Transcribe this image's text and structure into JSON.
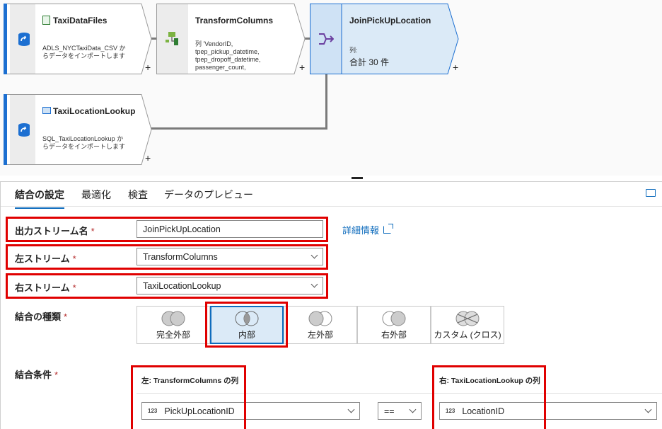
{
  "nodes": [
    {
      "title": "TaxiDataFiles",
      "desc": "ADLS_NYCTaxiData_CSV からデータをインポートします",
      "icon": "source-icon"
    },
    {
      "title": "TransformColumns",
      "desc": "列 'VendorID, tpep_pickup_datetime, tpep_dropoff_datetime, passenger_count,",
      "icon": "transform-icon"
    },
    {
      "title": "JoinPickUpLocation",
      "desc_label": "列:",
      "desc_value": "合計 30 件",
      "icon": "join-icon"
    },
    {
      "title": "TaxiLocationLookup",
      "desc": "SQL_TaxiLocationLookup からデータをインポートします",
      "icon": "source-icon"
    }
  ],
  "plus": "+",
  "tabs": [
    "結合の設定",
    "最適化",
    "検査",
    "データのプレビュー"
  ],
  "form": {
    "output_label": "出力ストリーム名",
    "output_value": "JoinPickUpLocation",
    "left_label": "左ストリーム",
    "left_value": "TransformColumns",
    "right_label": "右ストリーム",
    "right_value": "TaxiLocationLookup",
    "required": "*",
    "more_info": "詳細情報",
    "join_type_label": "結合の種類",
    "join_types": [
      "完全外部",
      "内部",
      "左外部",
      "右外部",
      "カスタム (クロス)"
    ],
    "selected_join": "内部",
    "cond_label": "結合条件",
    "left_col_header": "左: TransformColumns の列",
    "right_col_header": "右: TaxiLocationLookup の列",
    "left_col_value": "PickUpLocationID",
    "operator": "==",
    "right_col_value": "LocationID",
    "type_tag": "123"
  },
  "colors": {
    "accent": "#0f6cbd",
    "highlight": "#e00000",
    "selected_node": "#dbeaf7",
    "source_bar": "#1c6fd1"
  }
}
